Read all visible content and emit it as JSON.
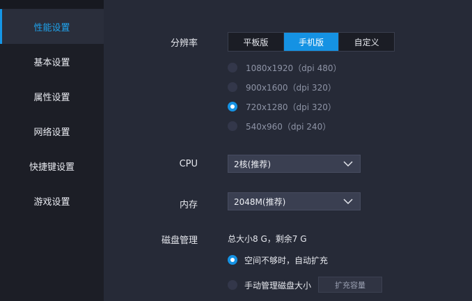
{
  "sidebar": {
    "items": [
      {
        "label": "性能设置",
        "active": true
      },
      {
        "label": "基本设置"
      },
      {
        "label": "属性设置"
      },
      {
        "label": "网络设置"
      },
      {
        "label": "快捷键设置"
      },
      {
        "label": "游戏设置"
      }
    ]
  },
  "resolution": {
    "label": "分辨率",
    "modes": [
      "平板版",
      "手机版",
      "自定义"
    ],
    "selected_mode": "手机版",
    "options": [
      "1080x1920（dpi 480）",
      "900x1600（dpi 320）",
      "720x1280（dpi 320）",
      "540x960（dpi 240）"
    ],
    "selected_option": "720x1280（dpi 320）"
  },
  "cpu": {
    "label": "CPU",
    "value": "2核(推荐)"
  },
  "memory": {
    "label": "内存",
    "value": "2048M(推荐)"
  },
  "disk": {
    "label": "磁盘管理",
    "info": "总大小8 G，剩余7 G",
    "options": [
      "空间不够时，自动扩充",
      "手动管理磁盘大小"
    ],
    "selected_option": "空间不够时，自动扩充",
    "expand_button": "扩充容量"
  },
  "colors": {
    "accent": "#1592e3",
    "sidebar_bg": "#1c1e26",
    "content_bg": "#262a37"
  },
  "icons": {
    "dropdown": "chevron-down-icon"
  }
}
